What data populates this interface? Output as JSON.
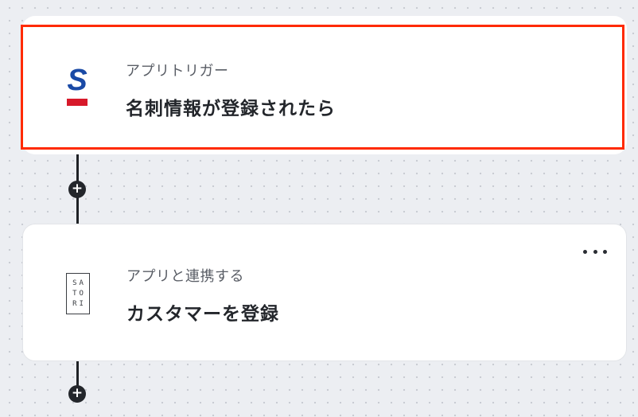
{
  "trigger_card": {
    "icon": "sansan-logo-icon",
    "subtitle": "アプリトリガー",
    "title": "名刺情報が登録されたら",
    "highlight_color": "#ff2a00"
  },
  "action_card": {
    "icon": "satori-logo-icon",
    "logo_lines": [
      "SA",
      "TO",
      "RI"
    ],
    "subtitle": "アプリと連携する",
    "title": "カスタマーを登録",
    "menu_icon": "more-horizontal-icon"
  },
  "add_step_icon": "plus-icon",
  "colors": {
    "sansan_blue": "#1a4aa6",
    "sansan_red": "#d7192a",
    "connector": "#1f2226"
  }
}
